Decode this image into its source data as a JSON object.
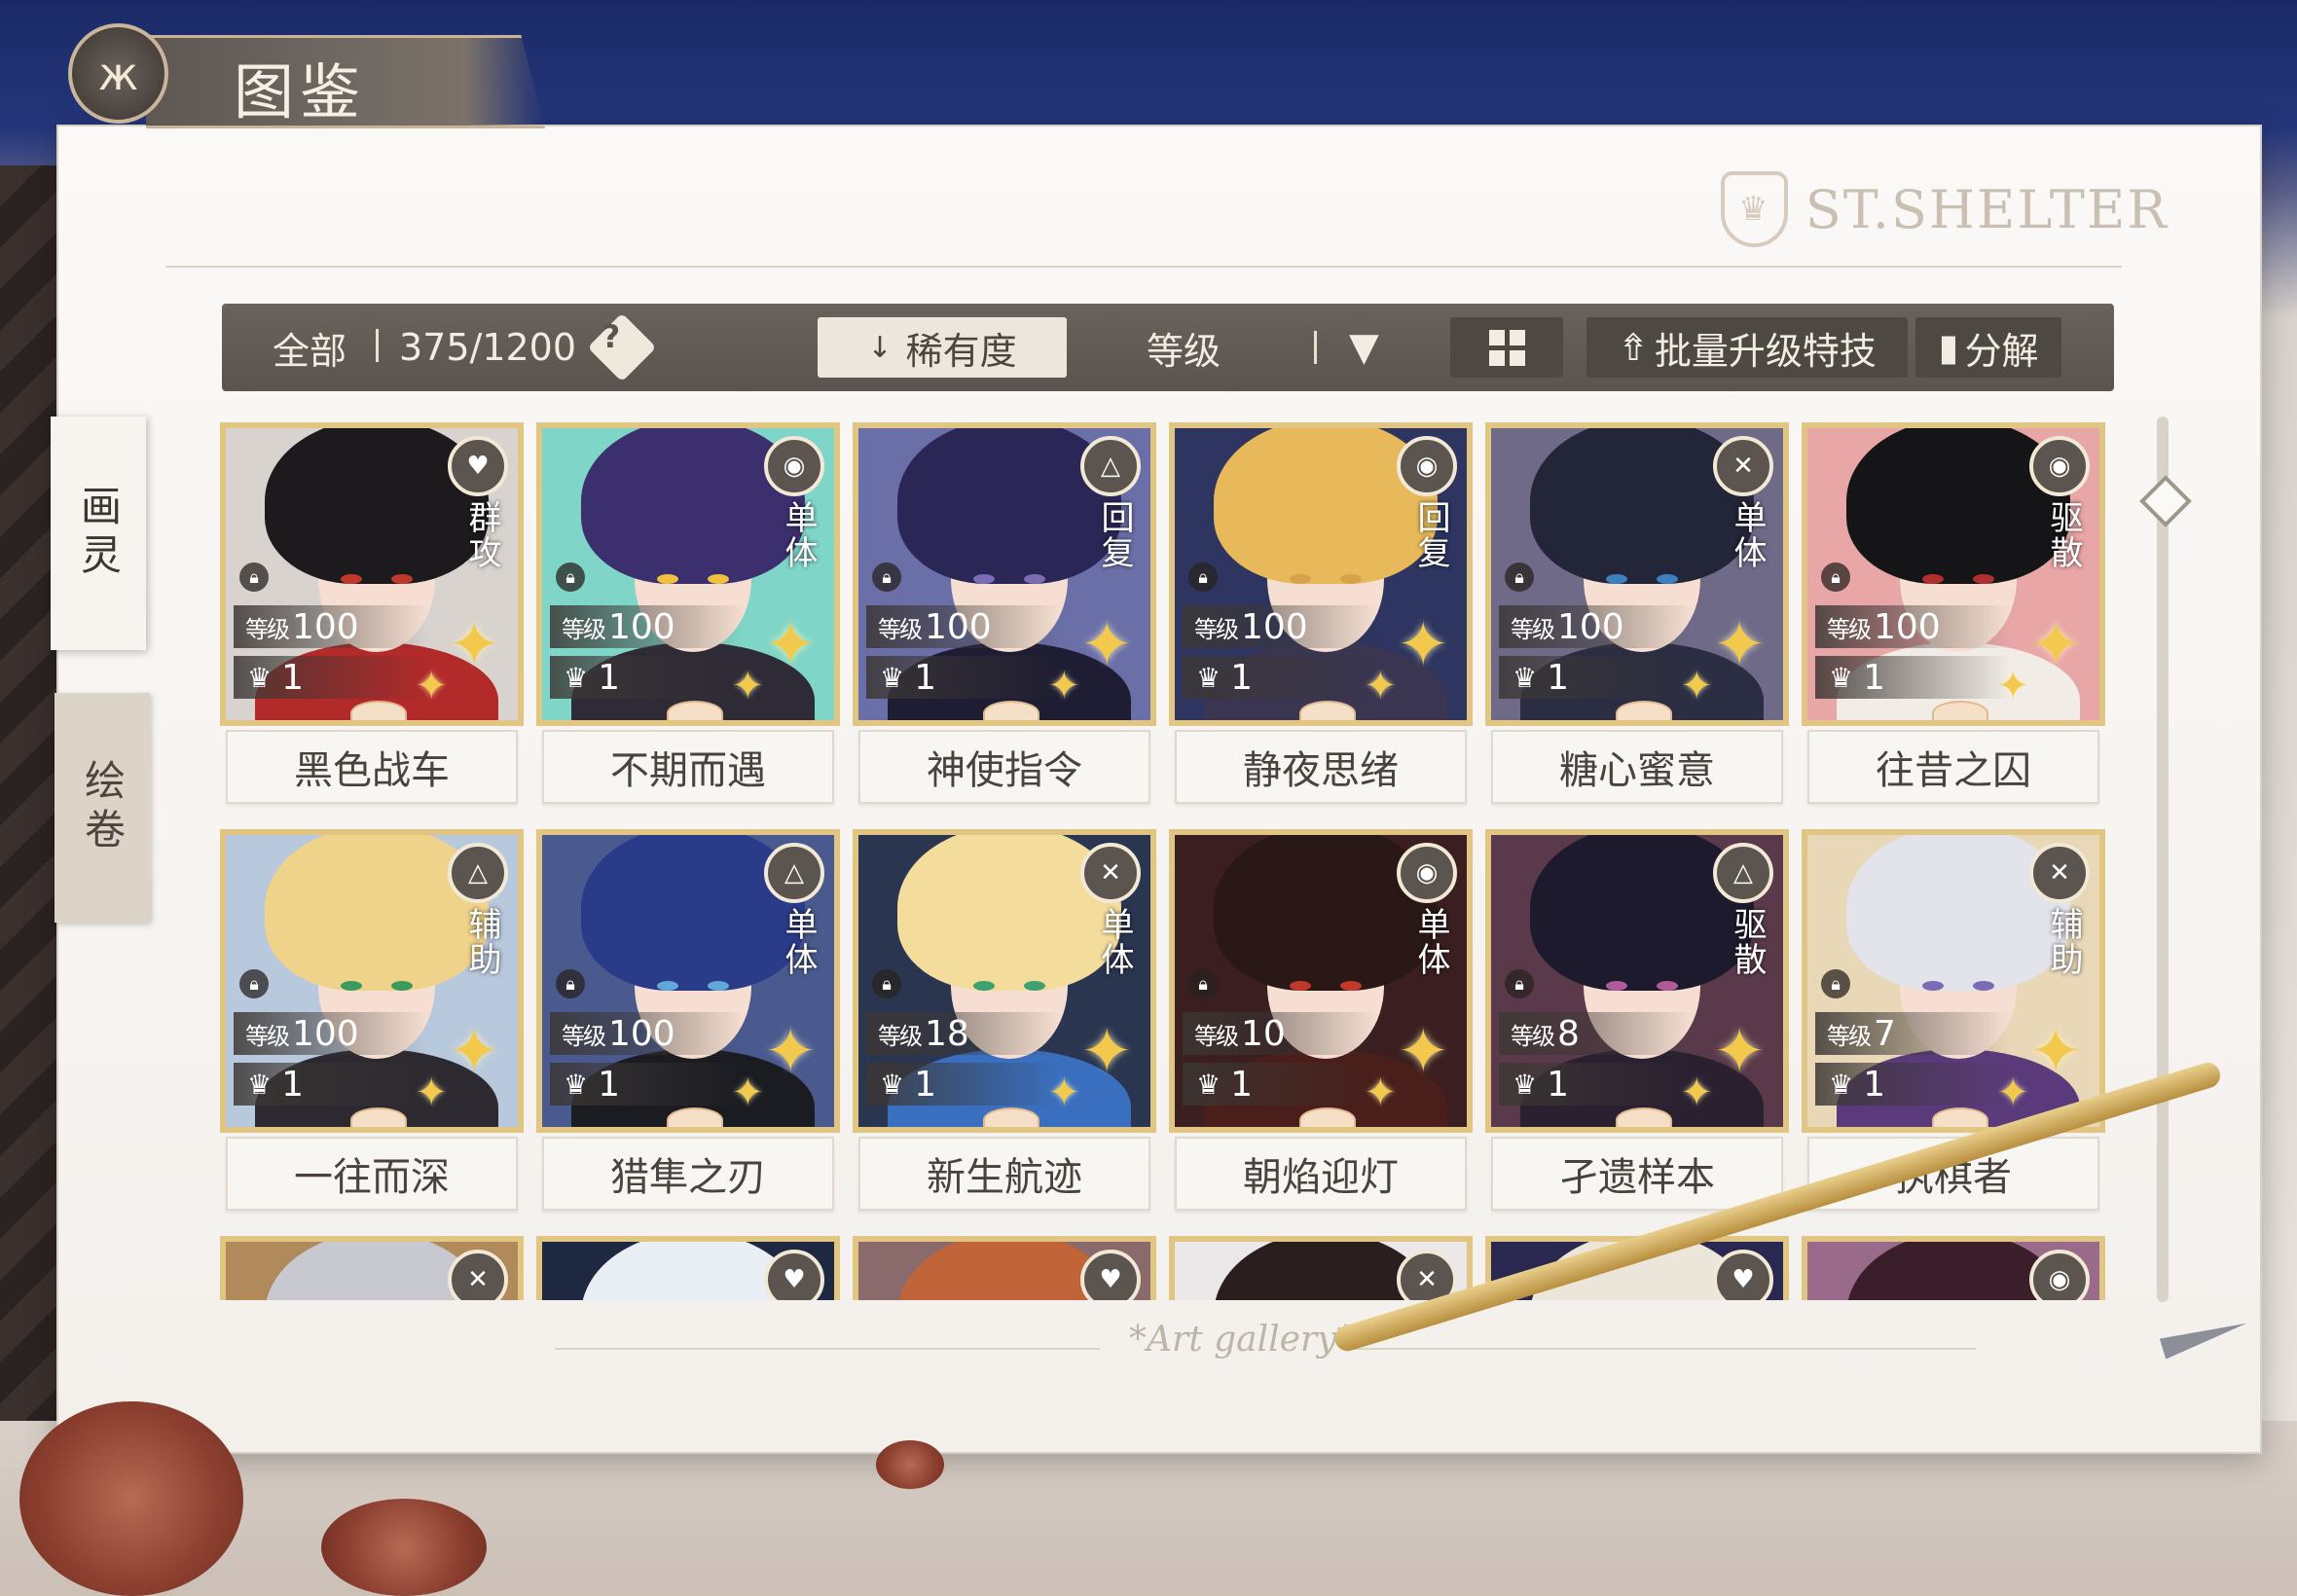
{
  "header": {
    "title": "图鉴",
    "emblem_icon": "butterfly-icon"
  },
  "brand": "ST.SHELTER",
  "toolbar": {
    "filter_all": "全部",
    "count": "375/1200",
    "help_label": "?",
    "sort_label": "稀有度",
    "level_label": "等级",
    "batch_label": "批量升级特技",
    "decompose_label": "分解"
  },
  "side_tabs": [
    {
      "label": "画灵",
      "active": true
    },
    {
      "label": "绘卷",
      "active": false
    }
  ],
  "cards": [
    {
      "name": "黑色战车",
      "role": "群攻",
      "role_icon": "heart-pulse-icon",
      "level_label": "等级",
      "level": "100",
      "stars": "1",
      "hair": "#1c1a1d",
      "outfit": "#b22a2a",
      "bg": "#d9d3cf",
      "eye": "#c0392b"
    },
    {
      "name": "不期而遇",
      "role": "单体",
      "role_icon": "target-icon",
      "level_label": "等级",
      "level": "100",
      "stars": "1",
      "hair": "#3c2f6e",
      "outfit": "#2e2a36",
      "bg": "#7fd6c8",
      "eye": "#f0c040"
    },
    {
      "name": "神使指令",
      "role": "回复",
      "role_icon": "triangle-circle-icon",
      "level_label": "等级",
      "level": "100",
      "stars": "1",
      "hair": "#2a2757",
      "outfit": "#1f1d33",
      "bg": "#6a6fa8",
      "eye": "#7d6bb5"
    },
    {
      "name": "静夜思绪",
      "role": "回复",
      "role_icon": "target-icon",
      "level_label": "等级",
      "level": "100",
      "stars": "1",
      "hair": "#e8b95a",
      "outfit": "#3a3550",
      "bg": "#2d3560",
      "eye": "#d8a24a"
    },
    {
      "name": "糖心蜜意",
      "role": "单体",
      "role_icon": "cross-diamond-icon",
      "level_label": "等级",
      "level": "100",
      "stars": "1",
      "hair": "#232538",
      "outfit": "#2b2d42",
      "bg": "#6f6a88",
      "eye": "#3f7fbf"
    },
    {
      "name": "往昔之囚",
      "role": "驱散",
      "role_icon": "target-icon",
      "level_label": "等级",
      "level": "100",
      "stars": "1",
      "hair": "#151416",
      "outfit": "#f1ece6",
      "bg": "#e9a6a6",
      "eye": "#b03030"
    },
    {
      "name": "一往而深",
      "role": "辅助",
      "role_icon": "triangle-circle-icon",
      "level_label": "等级",
      "level": "100",
      "stars": "1",
      "hair": "#f0d38a",
      "outfit": "#2c2a30",
      "bg": "#b9c9dd",
      "eye": "#3e9a5c"
    },
    {
      "name": "猎隼之刃",
      "role": "单体",
      "role_icon": "triangle-circle-icon",
      "level_label": "等级",
      "level": "100",
      "stars": "1",
      "hair": "#2a3b8a",
      "outfit": "#1b1c22",
      "bg": "#4a5a8f",
      "eye": "#5fa8d8"
    },
    {
      "name": "新生航迹",
      "role": "单体",
      "role_icon": "cross-diamond-icon",
      "level_label": "等级",
      "level": "18",
      "stars": "1",
      "hair": "#f4dc9c",
      "outfit": "#3a6fbf",
      "bg": "#2a3550",
      "eye": "#3fa070"
    },
    {
      "name": "朝焰迎灯",
      "role": "单体",
      "role_icon": "target-icon",
      "level_label": "等级",
      "level": "10",
      "stars": "1",
      "hair": "#2a1816",
      "outfit": "#4a1e1a",
      "bg": "#3a1e20",
      "eye": "#c0392b"
    },
    {
      "name": "孑遗样本",
      "role": "驱散",
      "role_icon": "triangle-circle-icon",
      "level_label": "等级",
      "level": "8",
      "stars": "1",
      "hair": "#1e1a2e",
      "outfit": "#2a2030",
      "bg": "#5a3a4a",
      "eye": "#b05a9a"
    },
    {
      "name": "执棋者",
      "role": "辅助",
      "role_icon": "cross-diamond-icon",
      "level_label": "等级",
      "level": "7",
      "stars": "1",
      "hair": "#e3e3ec",
      "outfit": "#5a3a7a",
      "bg": "#e9d8b8",
      "eye": "#7a6bb5"
    },
    {
      "name": "",
      "role": "",
      "role_icon": "cross-diamond-icon",
      "level_label": "",
      "level": "",
      "stars": "",
      "hair": "#c8c8d0",
      "outfit": "#6a5a50",
      "bg": "#b08a5a",
      "eye": "#777"
    },
    {
      "name": "",
      "role": "",
      "role_icon": "heart-pulse-icon",
      "level_label": "",
      "level": "",
      "stars": "",
      "hair": "#e9eef5",
      "outfit": "#1e2840",
      "bg": "#1e2840",
      "eye": "#777"
    },
    {
      "name": "",
      "role": "",
      "role_icon": "heart-pulse-icon",
      "level_label": "",
      "level": "",
      "stars": "",
      "hair": "#c2643a",
      "outfit": "#6a5050",
      "bg": "#8a6a6a",
      "eye": "#777"
    },
    {
      "name": "",
      "role": "",
      "role_icon": "cross-diamond-icon",
      "level_label": "",
      "level": "",
      "stars": "",
      "hair": "#2a1e1e",
      "outfit": "#d9d0cc",
      "bg": "#ece8ea",
      "eye": "#777"
    },
    {
      "name": "",
      "role": "",
      "role_icon": "heart-pulse-icon",
      "level_label": "",
      "level": "",
      "stars": "",
      "hair": "#ece6da",
      "outfit": "#2a2850",
      "bg": "#2a2850",
      "eye": "#777"
    },
    {
      "name": "",
      "role": "",
      "role_icon": "target-icon",
      "level_label": "",
      "level": "",
      "stars": "",
      "hair": "#3a1e2a",
      "outfit": "#7a4a6a",
      "bg": "#9a6a8a",
      "eye": "#777"
    }
  ],
  "footer": {
    "caption": "*Art gallery*"
  },
  "colors": {
    "card_border": "#e1c582",
    "toolbar": "#5e5752",
    "accent_gold": "#f2c94c"
  }
}
